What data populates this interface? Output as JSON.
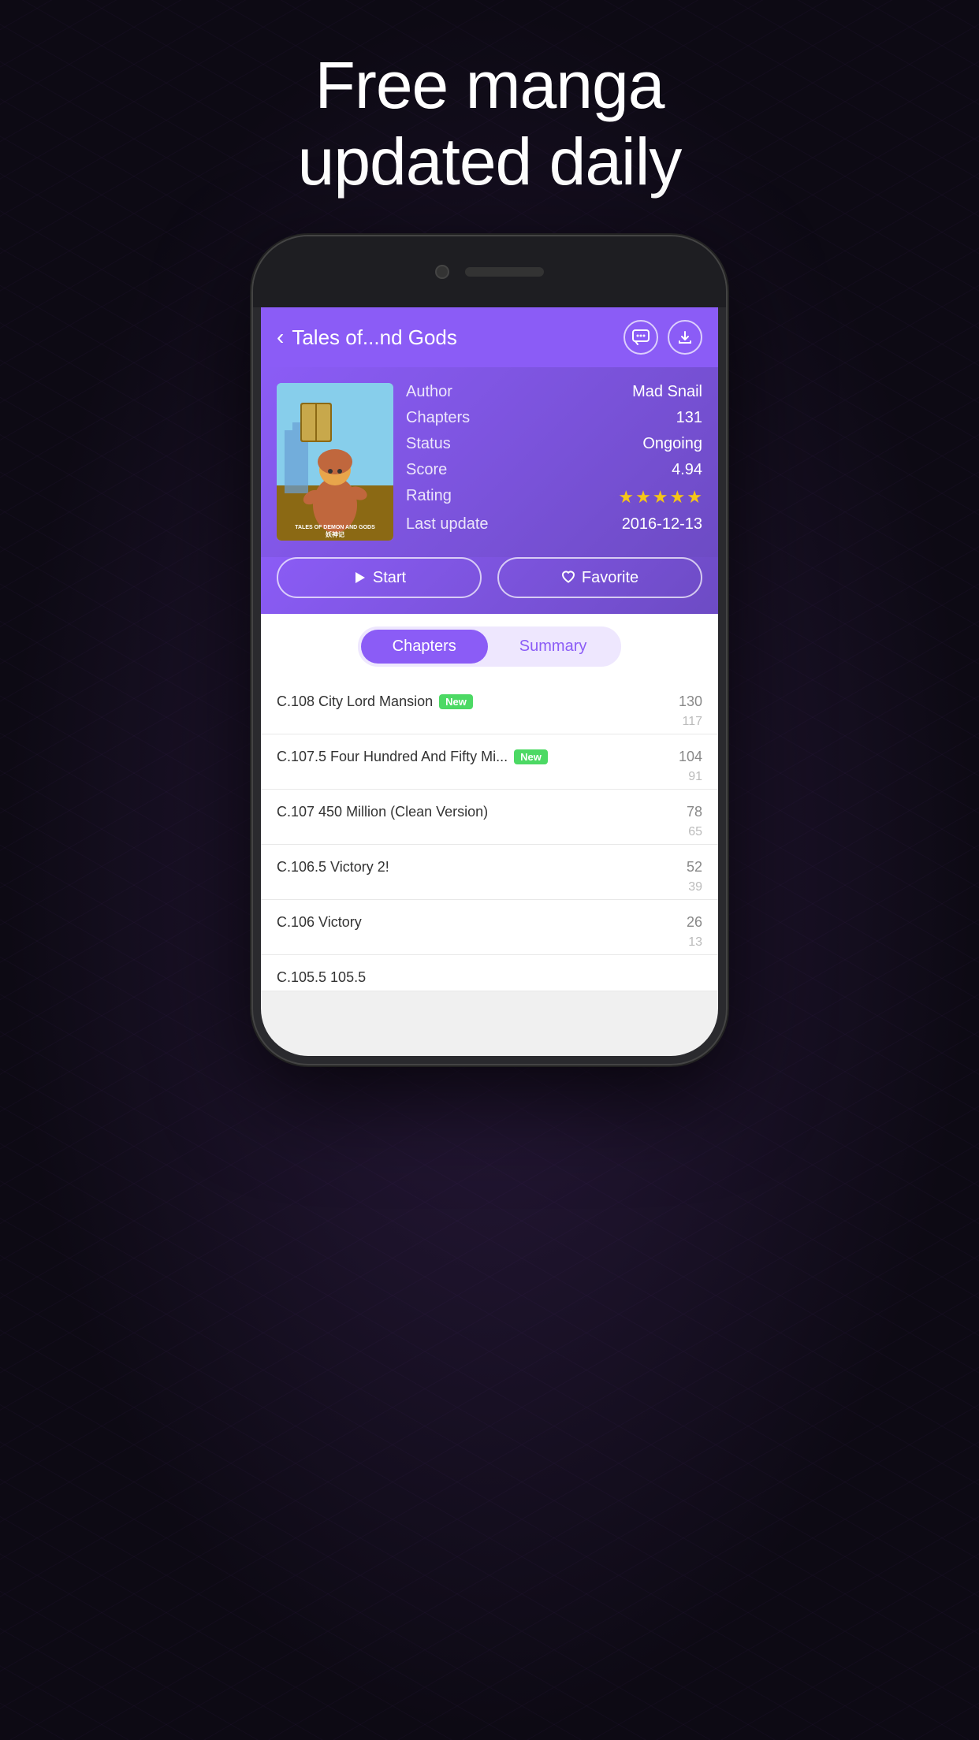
{
  "background": {
    "gradient_start": "#2a1a3e",
    "gradient_end": "#0d0a14"
  },
  "tagline": {
    "line1": "Free manga",
    "line2": "updated daily"
  },
  "app": {
    "header": {
      "back_label": "‹",
      "title": "Tales of...nd Gods",
      "chat_icon": "💬",
      "download_icon": "⬇"
    },
    "manga": {
      "author_label": "Author",
      "author_value": "Mad Snail",
      "chapters_label": "Chapters",
      "chapters_value": "131",
      "status_label": "Status",
      "status_value": "Ongoing",
      "score_label": "Score",
      "score_value": "4.94",
      "rating_label": "Rating",
      "stars_count": 5,
      "last_update_label": "Last update",
      "last_update_value": "2016-12-13"
    },
    "buttons": {
      "start_label": "Start",
      "favorite_label": "Favorite"
    },
    "tabs": {
      "chapters_label": "Chapters",
      "summary_label": "Summary",
      "active": "Chapters"
    },
    "chapters": [
      {
        "title": "C.108 City Lord Mansion",
        "is_new": true,
        "num_top": "130",
        "num_bottom": "117"
      },
      {
        "title": "C.107.5 Four Hundred And Fifty Mi...",
        "is_new": true,
        "num_top": "104",
        "num_bottom": "91"
      },
      {
        "title": "C.107 450 Million (Clean Version)",
        "is_new": false,
        "num_top": "78",
        "num_bottom": "65"
      },
      {
        "title": "C.106.5 Victory 2!",
        "is_new": false,
        "num_top": "52",
        "num_bottom": "39"
      },
      {
        "title": "C.106 Victory",
        "is_new": false,
        "num_top": "26",
        "num_bottom": "13"
      },
      {
        "title": "C.105.5 105.5",
        "is_new": false,
        "num_top": "",
        "num_bottom": ""
      }
    ],
    "badges": {
      "new_label": "New"
    }
  }
}
